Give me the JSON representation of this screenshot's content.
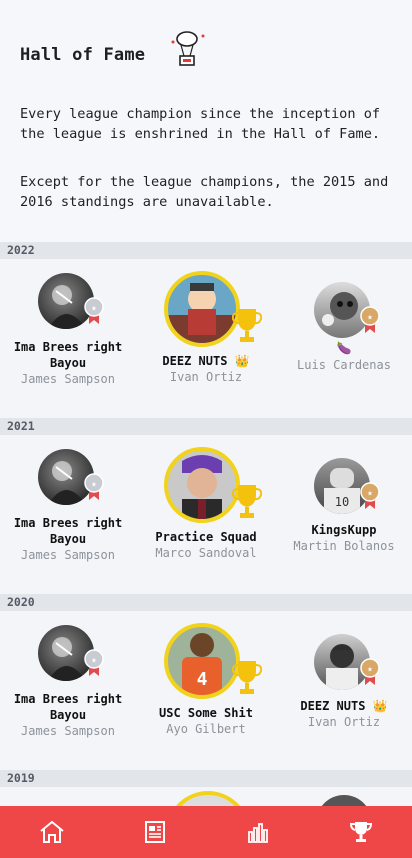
{
  "page": {
    "title": "Hall of Fame",
    "intro_1": "Every league champion since the inception of the league is enshrined in the Hall of Fame.",
    "intro_2": "Except for the league champions, the 2015 and 2016 standings are unavailable."
  },
  "years": [
    {
      "year": "2022",
      "second": {
        "team": "Ima Brees right Bayou",
        "owner": "James Sampson",
        "medal": "silver"
      },
      "first": {
        "team": "DEEZ NUTS",
        "team_emoji": "👑",
        "owner": "Ivan Ortiz",
        "medal": "gold"
      },
      "third": {
        "team": "",
        "team_emoji": "🍆",
        "owner": "Luis Cardenas",
        "medal": "bronze"
      }
    },
    {
      "year": "2021",
      "second": {
        "team": "Ima Brees right Bayou",
        "owner": "James Sampson",
        "medal": "silver"
      },
      "first": {
        "team": "Practice Squad",
        "owner": "Marco Sandoval",
        "medal": "gold"
      },
      "third": {
        "team": "KingsKupp",
        "owner": "Martin Bolanos",
        "medal": "bronze"
      }
    },
    {
      "year": "2020",
      "second": {
        "team": "Ima Brees right Bayou",
        "owner": "James Sampson",
        "medal": "silver"
      },
      "first": {
        "team": "USC Some Shit",
        "owner": "Ayo Gilbert",
        "medal": "gold"
      },
      "third": {
        "team": "DEEZ NUTS",
        "team_emoji": "👑",
        "owner": "Ivan Ortiz",
        "medal": "bronze"
      }
    },
    {
      "year": "2019"
    }
  ],
  "tabs": [
    {
      "icon": "home-icon"
    },
    {
      "icon": "news-icon"
    },
    {
      "icon": "standings-icon"
    },
    {
      "icon": "trophy-icon"
    }
  ],
  "colors": {
    "accent": "#ef4747",
    "gold_ring": "#f2d31b",
    "owner_text": "#8d929b"
  }
}
